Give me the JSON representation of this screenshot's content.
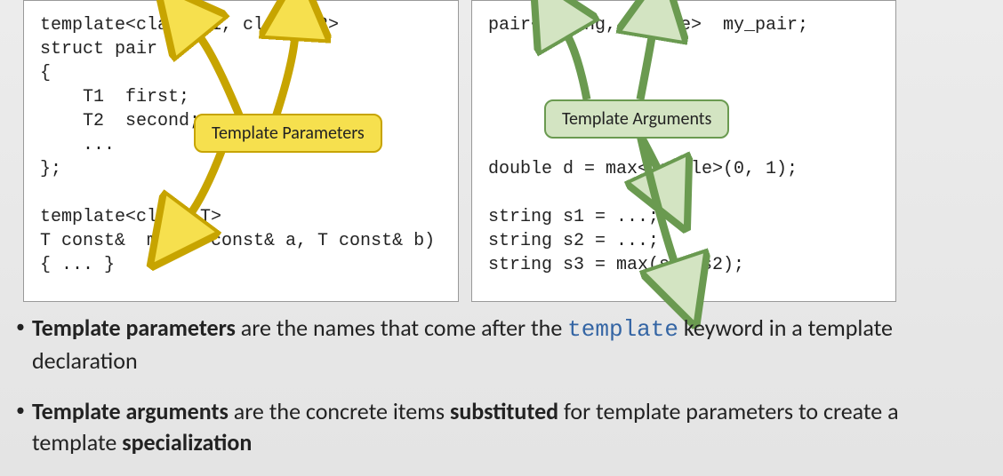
{
  "left_code": "template<class T1, class T2>\nstruct pair\n{\n    T1  first;\n    T2  second;\n    ...\n};\n\ntemplate<class T>\nT const&  max(T const& a, T const& b)\n{ ... }",
  "right_code": "pair<string, double>  my_pair;\n\n\n\n\n\ndouble d = max<double>(0, 1);\n\nstring s1 = ...;\nstring s2 = ...;\nstring s3 = max(s1, s2);",
  "callouts": {
    "params": "Template Parameters",
    "args": "Template Arguments"
  },
  "bullets": {
    "b1_strong": "Template parameters",
    "b1_mid": " are the names that come after the ",
    "b1_kw": "template",
    "b1_end": " keyword in a template declaration",
    "b2_strong": "Template arguments",
    "b2_mid": " are the concrete items ",
    "b2_sub": "substituted",
    "b2_mid2": " for template parameters to create a template ",
    "b2_spec": "specialization"
  }
}
